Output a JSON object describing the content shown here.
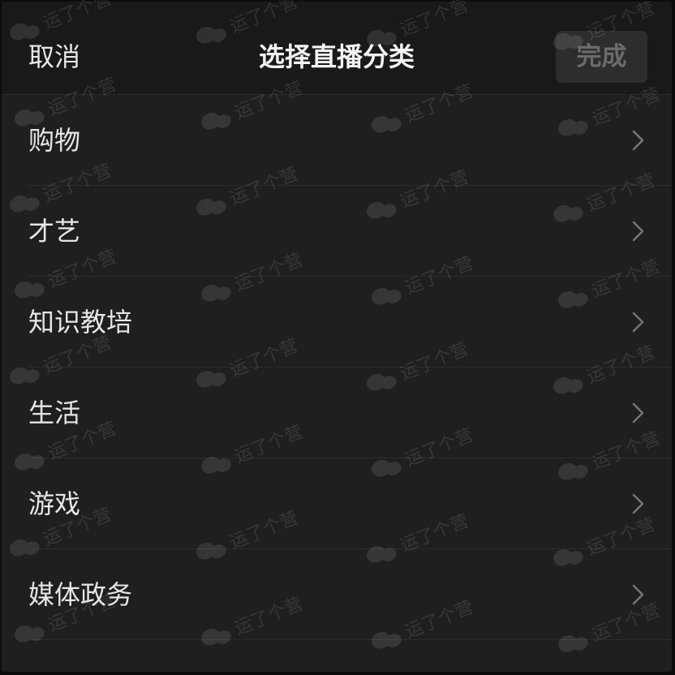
{
  "header": {
    "cancel_label": "取消",
    "title": "选择直播分类",
    "done_label": "完成"
  },
  "categories": [
    {
      "label": "购物"
    },
    {
      "label": "才艺"
    },
    {
      "label": "知识教培"
    },
    {
      "label": "生活"
    },
    {
      "label": "游戏"
    },
    {
      "label": "媒体政务"
    }
  ],
  "watermark": {
    "text": "运了个营",
    "icon": "wechat-icon"
  },
  "colors": {
    "background": "#1f1f1f",
    "header": "#191919",
    "done_button_bg": "#2d2d2d",
    "done_button_text": "#6b6b6b",
    "chevron": "#777777"
  }
}
